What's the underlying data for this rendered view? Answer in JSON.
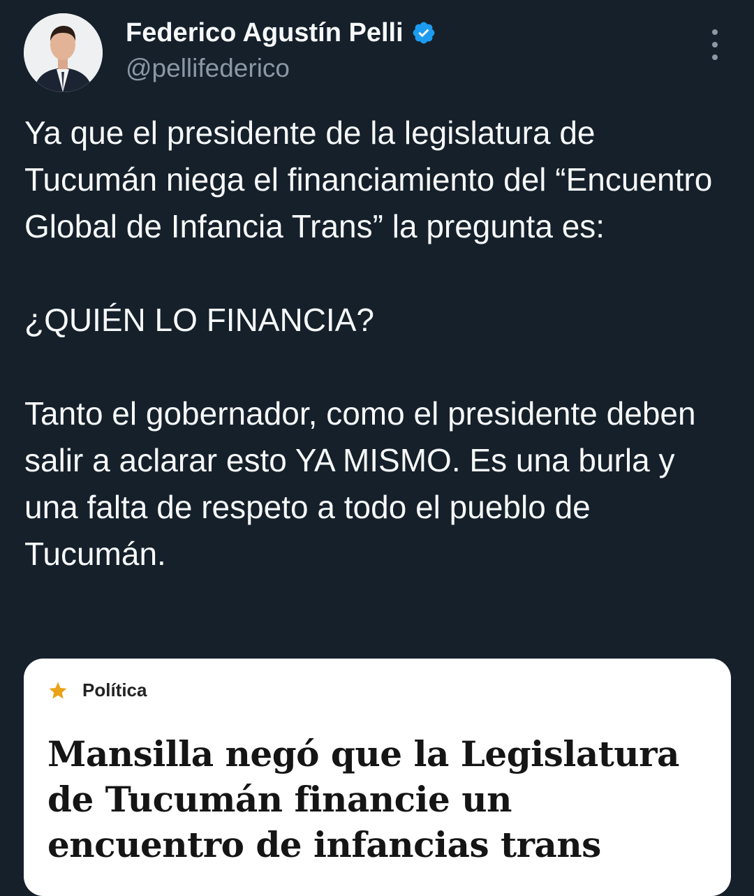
{
  "author": {
    "display_name": "Federico Agustín Pelli",
    "handle": "@pellifederico",
    "verified_icon": "verified-badge-icon",
    "verified_color": "#1d9bf0",
    "avatar": "profile-photo"
  },
  "menu_icon": "more-options-icon",
  "tweet": {
    "paragraphs": [
      "Ya que el presidente de la legislatura de Tucumán niega el financiamiento del “Encuentro Global de Infancia Trans” la pregunta es:",
      "¿QUIÉN LO FINANCIA?",
      "Tanto el gobernador, como el presidente deben salir a aclarar esto YA MISMO. Es una burla y una falta de respeto a todo el pueblo de Tucumán."
    ]
  },
  "card": {
    "section_icon": "star-icon",
    "section_icon_color": "#e8a317",
    "section_label": "Política",
    "headline": "Mansilla negó que la Legislatura de Tucumán financie un encuentro de infancias trans"
  },
  "colors": {
    "background": "#15202b",
    "text_primary": "#f7f9f9",
    "text_secondary": "#8b98a5",
    "card_background": "#ffffff"
  }
}
